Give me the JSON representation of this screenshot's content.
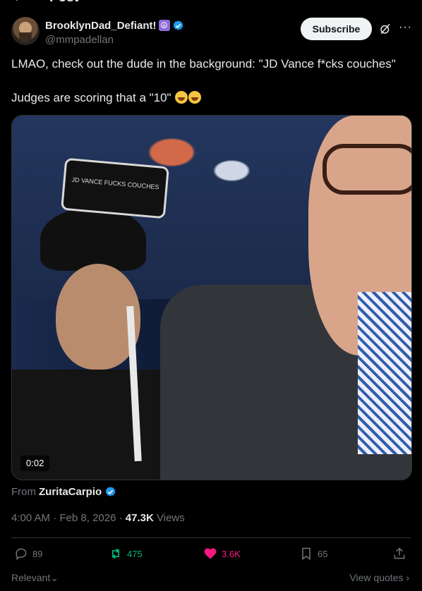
{
  "topbar": {
    "back_glyph": "←",
    "title": "Post"
  },
  "author": {
    "display_name": "BrooklynDad_Defiant!",
    "name_emoji": "☮",
    "handle": "@mmpadellan",
    "verified": true
  },
  "header_actions": {
    "subscribe_label": "Subscribe",
    "grok_icon": "grok-icon",
    "more_glyph": "···"
  },
  "tweet": {
    "line1": "LMAO, check out the dude in the background: \"JD Vance f*cks couches\"",
    "line2": "Judges are scoring that a \"10\""
  },
  "media": {
    "sign_text": "JD VANCE FUCKS COUCHES",
    "duration": "0:02"
  },
  "source": {
    "prefix": "From",
    "user": "ZuritaCarpio"
  },
  "meta": {
    "time": "4:00 AM",
    "date": "Feb 8, 2026",
    "views_count": "47.3K",
    "views_label": "Views",
    "separator": "·"
  },
  "actions": {
    "replies": "89",
    "reposts": "475",
    "likes": "3.6K",
    "bookmarks": "65"
  },
  "footer": {
    "sort_label": "Relevant",
    "sort_chevron": "⌄",
    "quotes_label": "View quotes",
    "quotes_chevron": "›"
  },
  "colors": {
    "accent_blue": "#1d9bf0",
    "repost_green": "#00ba7c",
    "like_pink": "#f91880",
    "muted": "#71767b"
  }
}
